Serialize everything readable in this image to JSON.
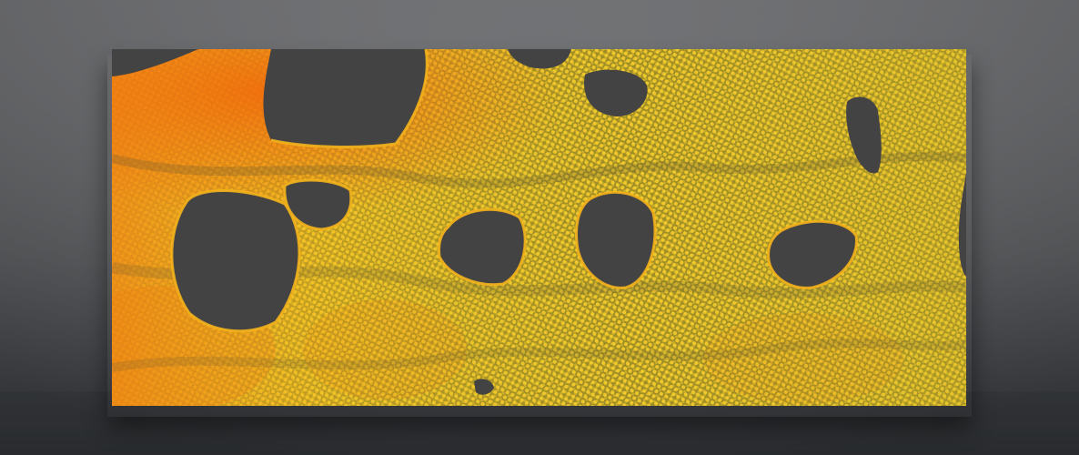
{
  "scene": {
    "subject": "",
    "colors": {
      "bg_light": "#6a6b6e",
      "bg_dark": "#34363a",
      "panel": "#434343",
      "dot_yellow": "#e8c21e",
      "dot_amber": "#f3a816",
      "dot_orange": "#f07a0f",
      "dot_olive": "#b9a225"
    }
  }
}
